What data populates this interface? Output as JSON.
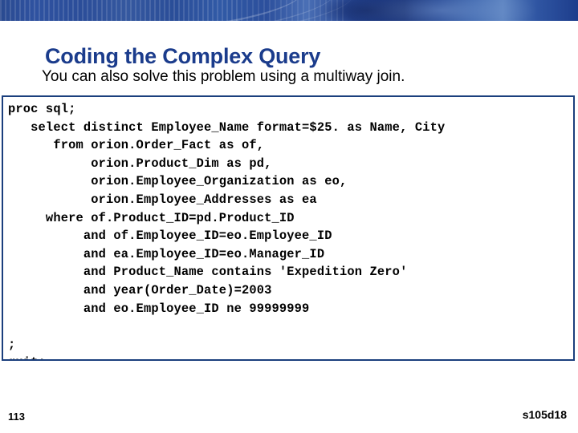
{
  "banner": {
    "name": "decorative-blue-banner",
    "gradient_start": "#2a4a90",
    "gradient_end": "#1d3d8c",
    "accent_dark": "#0e2870",
    "accent_light": "#5b82c0"
  },
  "slide": {
    "title": "Coding the Complex Query",
    "title_color": "#1b3c8c",
    "subtitle": "You can also solve this problem using a multiway join."
  },
  "code_block": {
    "border_color": "#1b3f7d",
    "background": "#ffffff",
    "text_color": "#000000",
    "language": "SAS SQL",
    "lines": [
      "proc sql;",
      "   select distinct Employee_Name format=$25. as Name, City",
      "      from orion.Order_Fact as of,",
      "           orion.Product_Dim as pd,",
      "           orion.Employee_Organization as eo,",
      "           orion.Employee_Addresses as ea",
      "     where of.Product_ID=pd.Product_ID",
      "          and of.Employee_ID=eo.Employee_ID",
      "          and ea.Employee_ID=eo.Manager_ID",
      "          and Product_Name contains 'Expedition Zero'",
      "          and year(Order_Date)=2003",
      "          and eo.Employee_ID ne 99999999",
      "",
      ";",
      "quit;"
    ],
    "text": "proc sql;\n   select distinct Employee_Name format=$25. as Name, City\n      from orion.Order_Fact as of,\n           orion.Product_Dim as pd,\n           orion.Employee_Organization as eo,\n           orion.Employee_Addresses as ea\n     where of.Product_ID=pd.Product_ID\n          and of.Employee_ID=eo.Employee_ID\n          and ea.Employee_ID=eo.Manager_ID\n          and Product_Name contains 'Expedition Zero'\n          and year(Order_Date)=2003\n          and eo.Employee_ID ne 99999999\n\n;\nquit;"
  },
  "footer": {
    "page_number": "113",
    "doc_code": "s105d18"
  }
}
